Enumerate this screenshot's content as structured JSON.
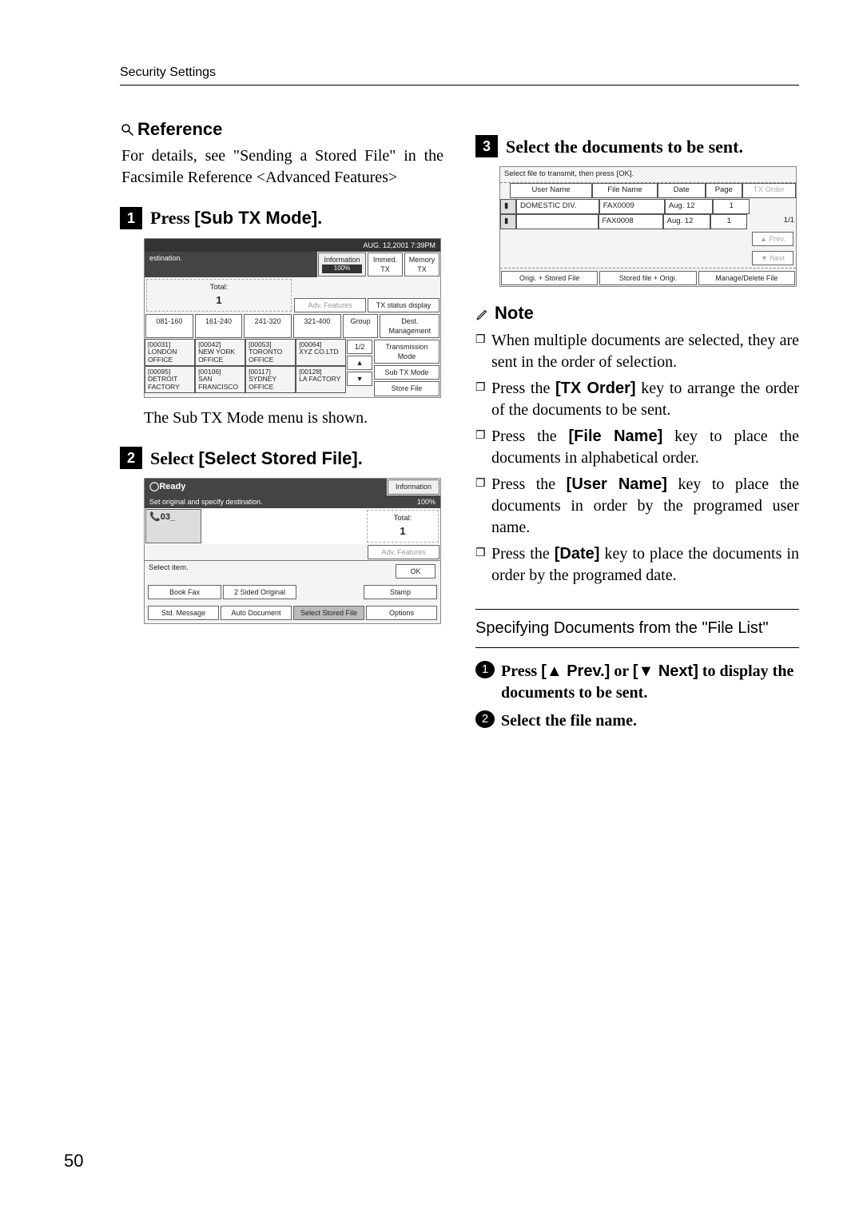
{
  "header": "Security Settings",
  "page_number": "50",
  "left": {
    "reference_label": "Reference",
    "reference_body": "For details, see \"Sending a Stored File\" in the Facsimile Reference <Advanced Features>",
    "step1_prefix": "Press ",
    "step1_label": "[Sub TX Mode].",
    "step1_after": "The Sub TX Mode menu is shown.",
    "step2_prefix": "Select ",
    "step2_label": "[Select Stored File].",
    "ss1": {
      "clock": "AUG.   12,2001   7:39PM",
      "dest": "estination.",
      "info": "Information",
      "pct": "100%",
      "immed": "Immed. TX",
      "memory": "Memory TX",
      "total_lbl": "Total:",
      "total_val": "1",
      "adv": "Adv. Features",
      "txstat": "TX status display",
      "ranges": [
        "081-160",
        "161-240",
        "241-320",
        "321-400",
        "Group"
      ],
      "destmgmt": "Dest. Management",
      "row1": [
        {
          "code": "[00031]",
          "name": "LONDON OFFICE"
        },
        {
          "code": "[00042]",
          "name": "NEW YORK OFFICE"
        },
        {
          "code": "[00053]",
          "name": "TORONTO OFFICE"
        },
        {
          "code": "[00064]",
          "name": "XYZ CO.LTD"
        }
      ],
      "row2": [
        {
          "code": "[00095]",
          "name": "DETROIT FACTORY"
        },
        {
          "code": "[00106]",
          "name": "SAN FRANCISCO"
        },
        {
          "code": "[00117]",
          "name": "SYDNEY OFFICE"
        },
        {
          "code": "[00128]",
          "name": "LA FACTORY"
        }
      ],
      "pager": "1/2",
      "submenu": [
        "Transmission Mode",
        "Sub TX Mode",
        "Store File"
      ]
    },
    "ss2": {
      "ready": "Ready",
      "info": "Information",
      "setorig": "Set original and specify destination.",
      "pct": "100%",
      "dial": "03_",
      "total_lbl": "Total:",
      "total_val": "1",
      "adv": "Adv. Features",
      "selectitem": "Select item.",
      "ok": "OK",
      "buttons": [
        "Book Fax",
        "2 Sided Original",
        "Stamp",
        "Std. Message",
        "Auto Document",
        "Select Stored File",
        "Options"
      ]
    }
  },
  "right": {
    "step3_text": "Select the documents to be sent.",
    "ss3": {
      "instr": "Select file to transmit, then press [OK].",
      "cols": [
        "User Name",
        "File Name",
        "Date",
        "Page",
        "TX Order"
      ],
      "rows": [
        {
          "user": "DOMESTIC DIV.",
          "file": "FAX0009",
          "date": "Aug.  12",
          "page": "1"
        },
        {
          "user": "",
          "file": "FAX0008",
          "date": "Aug.  12",
          "page": "1"
        }
      ],
      "pager": "1/1",
      "prev": "▲ Prev.",
      "next": "▼ Next",
      "bottom": [
        "Origi. + Stored File",
        "Stored file + Origi.",
        "Manage/Delete File"
      ]
    },
    "note_label": "Note",
    "notes": [
      "When multiple documents are selected, they are sent in the order of selection.",
      {
        "pre": "Press the ",
        "bold": "[TX Order]",
        "post": " key to arrange the order of the documents to be sent."
      },
      {
        "pre": "Press the ",
        "bold": "[File Name]",
        "post": " key to place the documents in alphabetical order."
      },
      {
        "pre": "Press the ",
        "bold": "[User Name]",
        "post": " key to place the documents in order by the programed user name."
      },
      {
        "pre": "Press the ",
        "bold": "[Date]",
        "post": " key to place the documents in order by the programed date."
      }
    ],
    "subheading": "Specifying Documents from the \"File List\"",
    "substep1_pre": "Press ",
    "substep1_prev": "[▲ Prev.]",
    "substep1_or": " or ",
    "substep1_next": "[▼ Next]",
    "substep1_post": " to display the documents to be sent.",
    "substep2": "Select the file name."
  }
}
